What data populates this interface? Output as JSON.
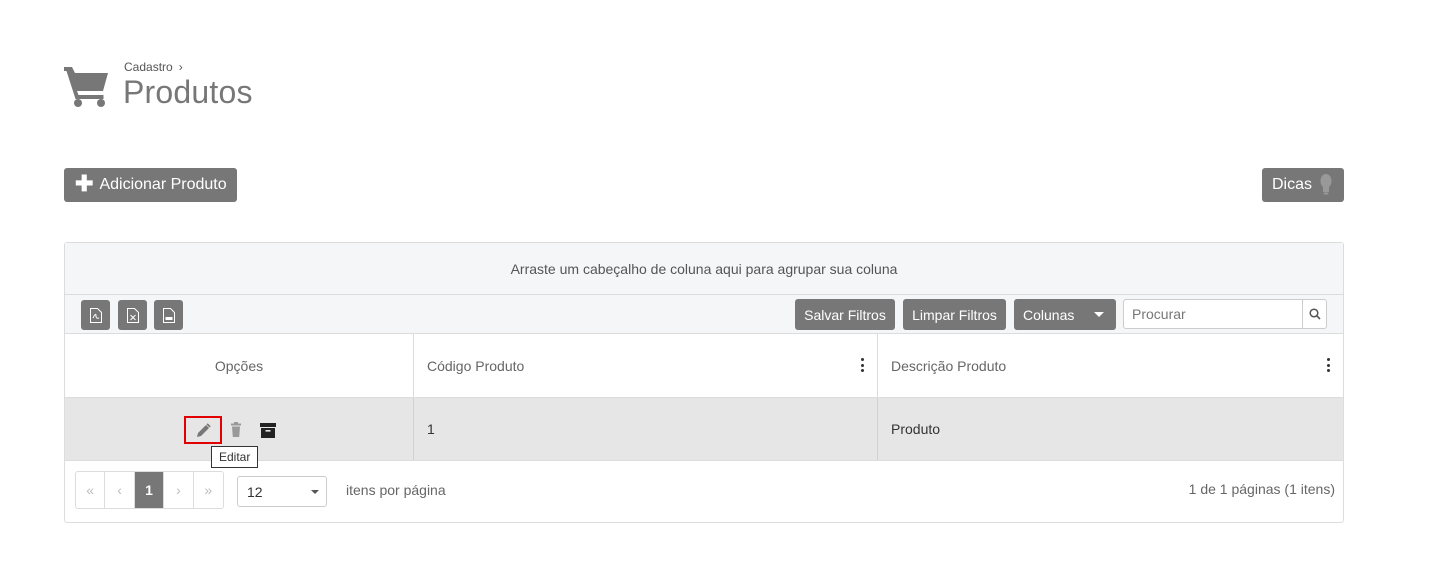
{
  "breadcrumb": {
    "parent": "Cadastro",
    "separator": "›"
  },
  "page": {
    "title": "Produtos"
  },
  "actions": {
    "add_label": "Adicionar Produto",
    "tips_label": "Dicas"
  },
  "grid": {
    "group_hint": "Arraste um cabeçalho de coluna aqui para agrupar sua coluna",
    "toolbar": {
      "save_filters": "Salvar Filtros",
      "clear_filters": "Limpar Filtros",
      "columns": "Colunas",
      "search_placeholder": "Procurar"
    },
    "columns": [
      "Opções",
      "Código Produto",
      "Descrição Produto"
    ],
    "rows": [
      {
        "codigo": "1",
        "descricao": "Produto"
      }
    ],
    "tooltip": "Editar",
    "pager": {
      "first": "«",
      "prev": "‹",
      "current": "1",
      "next": "›",
      "last": "»",
      "page_size": "12",
      "page_size_label": "itens por página",
      "info": "1 de 1 páginas (1 itens)"
    }
  },
  "icons": {
    "cart": "shopping-cart-icon",
    "plus": "plus-icon",
    "lightbulb": "lightbulb-icon",
    "pdf": "pdf-file-icon",
    "excel": "excel-file-icon",
    "csv": "csv-file-icon",
    "search": "search-icon",
    "edit": "pencil-icon",
    "delete": "trash-icon",
    "archive": "archive-icon"
  },
  "colors": {
    "button": "#777777",
    "highlight": "#e30000",
    "row_bg": "#e6e6e6"
  }
}
